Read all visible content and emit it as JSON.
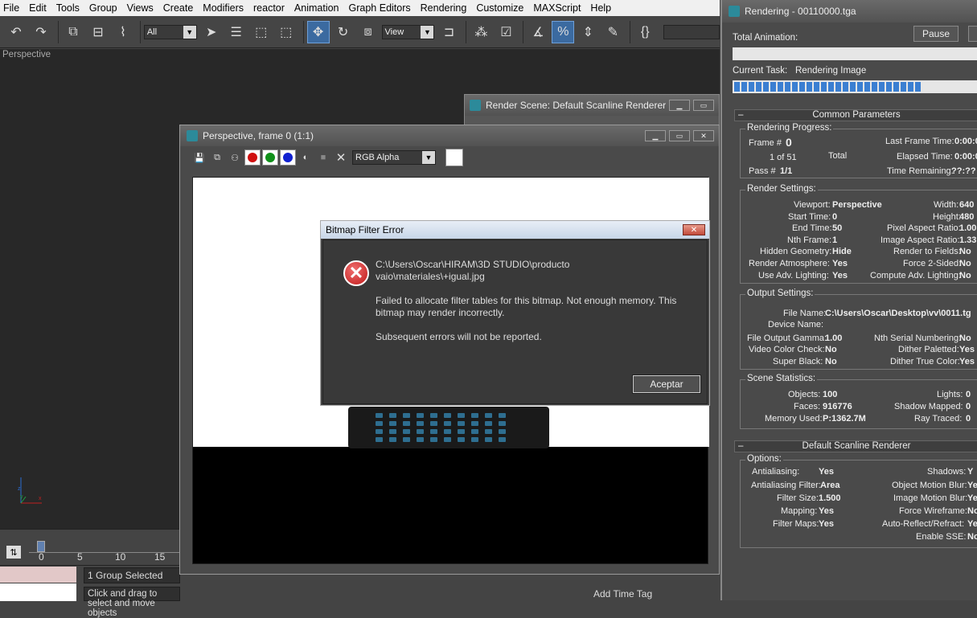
{
  "menu": [
    "File",
    "Edit",
    "Tools",
    "Group",
    "Views",
    "Create",
    "Modifiers",
    "reactor",
    "Animation",
    "Graph Editors",
    "Rendering",
    "Customize",
    "MAXScript",
    "Help"
  ],
  "toolbar": {
    "selection_filter": "All",
    "ref_coord": "View"
  },
  "viewport": {
    "label": "Perspective"
  },
  "timeline": {
    "ticks": [
      "0",
      "5",
      "10",
      "15"
    ]
  },
  "status": {
    "selection": "1 Group Selected",
    "prompt": "Click and drag to select and move objects",
    "add_time_tag": "Add Time Tag"
  },
  "render_scene_window": {
    "title": "Render Scene: Default Scanline Renderer"
  },
  "frame_window": {
    "title": "Perspective, frame 0 (1:1)",
    "channel": "RGB Alpha"
  },
  "error_dialog": {
    "title": "Bitmap Filter Error",
    "path_line1": "C:\\Users\\Oscar\\HIRAM\\3D STUDIO\\producto",
    "path_line2": "vaio\\materiales\\+igual.jpg",
    "msg_line1": "Failed to allocate filter tables for this bitmap. Not enough memory. This",
    "msg_line2": "bitmap may render incorrectly.",
    "msg_line3": "Subsequent errors will not be reported.",
    "ok_label": "Aceptar"
  },
  "rendering_panel": {
    "title": "Rendering - 00110000.tga",
    "total_animation": "Total Animation:",
    "pause": "Pause",
    "current_task_label": "Current Task:",
    "current_task": "Rendering Image",
    "progress_fraction": 0.78,
    "common_params": "Common Parameters",
    "rendering_progress": "Rendering Progress:",
    "frame_label": "Frame #",
    "frame_value": "0",
    "of_label": "1 of 51",
    "total_label": "Total",
    "pass_label": "Pass #",
    "pass_value": "1/1",
    "last_frame_time": "Last Frame Time:",
    "last_frame_value": "0:00:0",
    "elapsed_time": "Elapsed Time:",
    "elapsed_value": "0:00:0",
    "time_remaining": "Time Remaining:",
    "time_remaining_value": "??:??",
    "render_settings": "Render Settings:",
    "viewport_label": "Viewport:",
    "viewport_value": "Perspective",
    "width_label": "Width:",
    "width_value": "640",
    "start_label": "Start Time:",
    "start_value": "0",
    "height_label": "Height:",
    "height_value": "480",
    "end_label": "End Time:",
    "end_value": "50",
    "par_label": "Pixel Aspect Ratio:",
    "par_value": "1.00",
    "nth_label": "Nth Frame:",
    "nth_value": "1",
    "iar_label": "Image Aspect Ratio:",
    "iar_value": "1.33",
    "hidden_label": "Hidden Geometry:",
    "hidden_value": "Hide",
    "fields_label": "Render to Fields:",
    "fields_value": "No",
    "atmos_label": "Render Atmosphere:",
    "atmos_value": "Yes",
    "force2_label": "Force 2-Sided:",
    "force2_value": "No",
    "adv_label": "Use Adv. Lighting:",
    "adv_value": "Yes",
    "cadv_label": "Compute Adv. Lighting:",
    "cadv_value": "No",
    "output_settings": "Output Settings:",
    "file_label": "File Name:",
    "file_value": "C:\\Users\\Oscar\\Desktop\\vv\\0011.tg",
    "device_label": "Device Name:",
    "gamma_label": "File Output Gamma:",
    "gamma_value": "1.00",
    "serial_label": "Nth Serial Numbering:",
    "serial_value": "No",
    "vcc_label": "Video Color Check:",
    "vcc_value": "No",
    "dpal_label": "Dither Paletted:",
    "dpal_value": "Yes",
    "sblack_label": "Super Black:",
    "sblack_value": "No",
    "dtrue_label": "Dither True Color:",
    "dtrue_value": "Yes",
    "scene_stats": "Scene Statistics:",
    "objects_label": "Objects:",
    "objects_value": "100",
    "lights_label": "Lights:",
    "lights_value": "0",
    "faces_label": "Faces:",
    "faces_value": "916776",
    "shadow_label": "Shadow Mapped:",
    "shadow_value": "0",
    "mem_label": "Memory Used:",
    "mem_value": "P:1362.7M",
    "ray_label": "Ray Traced:",
    "ray_value": "0",
    "dsr": "Default Scanline Renderer",
    "options": "Options:",
    "aa_label": "Antialiasing:",
    "aa_value": "Yes",
    "shadows_label": "Shadows:",
    "shadows_value": "Y",
    "aaf_label": "Antialiasing Filter:",
    "aaf_value": "Area",
    "omb_label": "Object Motion Blur:",
    "omb_value": "Ye",
    "fs_label": "Filter Size:",
    "fs_value": "1.500",
    "imb_label": "Image Motion Blur:",
    "imb_value": "Ye",
    "map_label": "Mapping:",
    "map_value": "Yes",
    "fw_label": "Force Wireframe:",
    "fw_value": "No",
    "fm_label": "Filter Maps:",
    "fm_value": "Yes",
    "arr_label": "Auto-Reflect/Refract:",
    "arr_value": "Ye",
    "sse_label": "Enable SSE:",
    "sse_value": "No"
  }
}
